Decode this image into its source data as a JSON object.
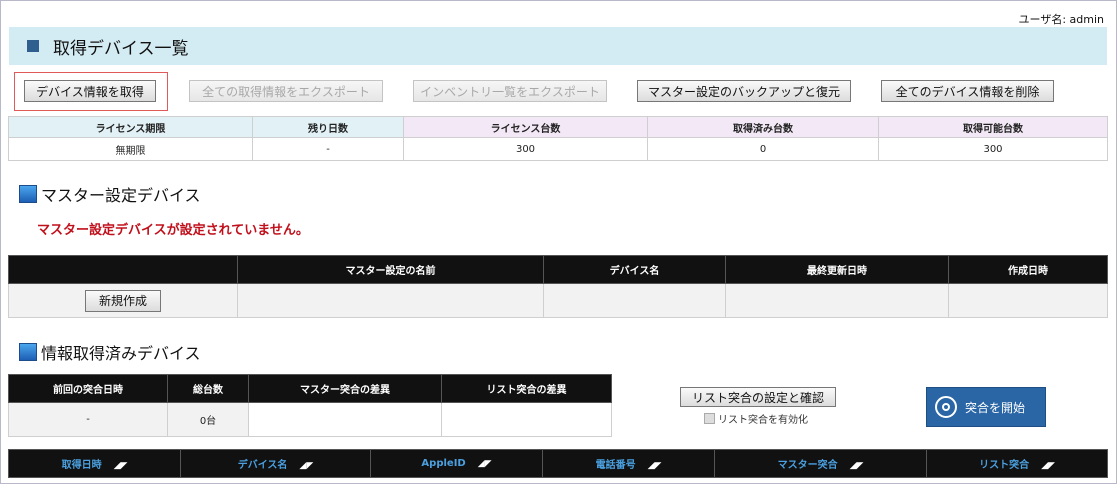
{
  "user_line": "ユーザ名: admin",
  "page_title": "取得デバイス一覧",
  "toolbar": {
    "get_device_info": "デバイス情報を取得",
    "export_all": "全ての取得情報をエクスポート",
    "export_inventory": "インベントリ一覧をエクスポート",
    "master_backup": "マスター設定のバックアップと復元",
    "delete_all": "全てのデバイス情報を削除"
  },
  "license": {
    "headers": [
      "ライセンス期限",
      "残り日数",
      "ライセンス台数",
      "取得済み台数",
      "取得可能台数"
    ],
    "values": [
      "無期限",
      "-",
      "300",
      "0",
      "300"
    ]
  },
  "master_section": {
    "title": "マスター設定デバイス",
    "warning": "マスター設定デバイスが設定されていません。",
    "headers": [
      "",
      "マスター設定の名前",
      "デバイス名",
      "最終更新日時",
      "作成日時"
    ],
    "new_button": "新規作成"
  },
  "acquired_section": {
    "title": "情報取得済みデバイス",
    "cmp_headers": [
      "前回の突合日時",
      "総台数",
      "マスター突合の差異",
      "リスト突合の差異"
    ],
    "cmp_values": [
      "-",
      "0台",
      "",
      ""
    ],
    "list_settings_button": "リスト突合の設定と確認",
    "enable_list_check": "リスト突合を有効化",
    "start_button": "突合を開始",
    "columns": [
      "取得日時",
      "デバイス名",
      "AppleID",
      "電話番号",
      "マスター突合",
      "リスト突合"
    ]
  },
  "colors": {
    "title_bar": "#d3ebf2",
    "warning": "#c0101b",
    "start_button": "#2a66a5",
    "header_dark": "#111111"
  }
}
